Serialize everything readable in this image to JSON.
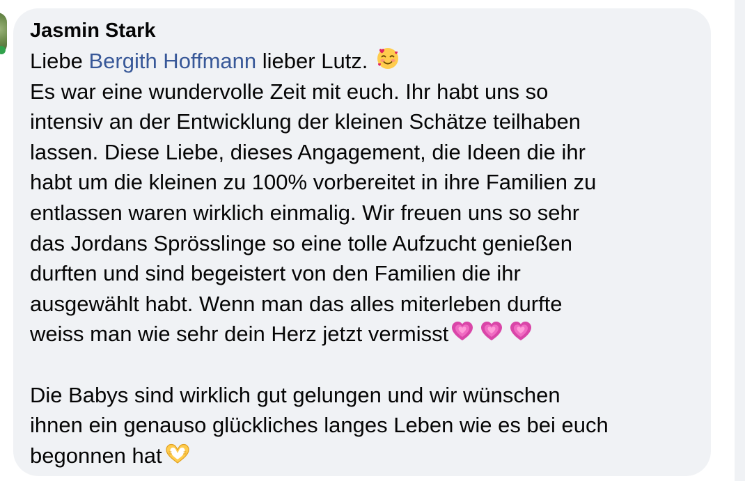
{
  "comment": {
    "author": "Jasmin Stark",
    "line1_prefix": "Liebe ",
    "mention": "Bergith Hoffmann",
    "line1_suffix": " lieber Lutz. ",
    "lines_paragraph1": [
      "Es war eine wundervolle Zeit mit euch. Ihr habt uns so",
      "intensiv an der Entwicklung der kleinen Schätze teilhaben",
      "lassen. Diese Liebe, dieses Angagement, die Ideen die ihr",
      "habt um die kleinen zu 100% vorbereitet in ihre Familien zu",
      "entlassen waren wirklich einmalig. Wir freuen uns so sehr",
      "das Jordans Sprösslinge so eine tolle Aufzucht genießen",
      "durften und sind begeistert von den Familien die ihr",
      "ausgewählt habt. Wenn man das alles miterleben durfte"
    ],
    "last_line_p1": "weiss man wie sehr dein Herz jetzt vermisst",
    "lines_paragraph2": [
      "Die Babys sind wirklich gut gelungen und wir wünschen",
      "ihnen ein genauso glückliches langes Leben wie es bei euch"
    ],
    "last_line_p2": "begonnen hat",
    "emojis": {
      "after_greeting": "smiling-face-with-hearts",
      "after_vermisst": [
        "growing-heart",
        "growing-heart",
        "growing-heart"
      ],
      "after_begonnen": "heart-hands"
    },
    "colors": {
      "bubble": "#f0f2f5",
      "text": "#050505",
      "mention": "#385898"
    }
  }
}
